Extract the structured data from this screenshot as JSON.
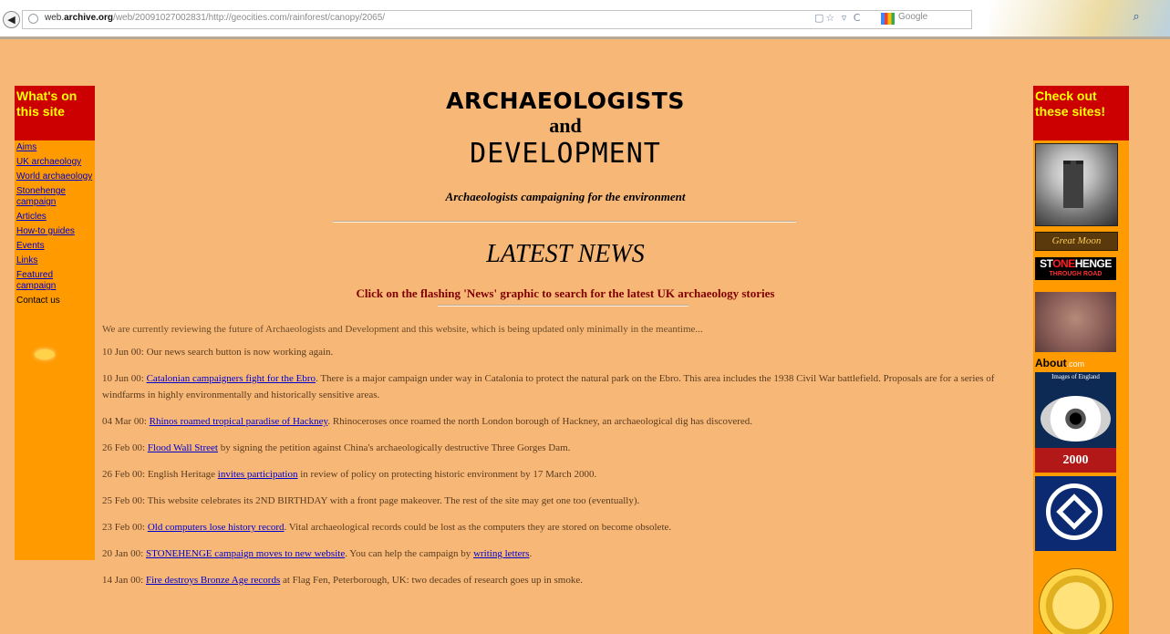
{
  "browser": {
    "url_prefix": "web.",
    "url_host": "archive.org",
    "url_path": "/web/20091027002831/http://geocities.com/rainforest/canopy/2065/",
    "search_placeholder": "Google",
    "back_icon": "arrow-left-icon",
    "toolbar_icons": "▢☆ ▿ C"
  },
  "leftnav": {
    "heading": "What's on this site",
    "links": [
      "Aims",
      "UK archaeology",
      "World archaeology",
      "Stonehenge campaign",
      "Articles",
      "How-to guides",
      "Events",
      "Links",
      "Featured campaign"
    ],
    "contact": "Contact us"
  },
  "header": {
    "title_line1": "ARCHAEOLOGISTS",
    "title_line2": "and",
    "title_line3": "DEVELOPMENT",
    "tagline": "Archaeologists campaigning for the environment"
  },
  "latest": {
    "heading": "LATEST NEWS",
    "flash_note": "Click on the flashing 'News' graphic to search for the latest UK archaeology stories"
  },
  "news": {
    "intro": "We are currently reviewing the future of Archaeologists and Development and this website, which is being updated only minimally in the meantime...",
    "items": [
      {
        "date": "10 Jun 00: ",
        "link": "",
        "text": "Our news search button is now working again."
      },
      {
        "date": "10 Jun 00: ",
        "link": "Catalonian campaigners fight for the Ebro",
        "text": ". There is a major campaign under way in Catalonia to protect the natural park on the Ebro. This area includes the 1938 Civil War battlefield. Proposals are for a series of windfarms in highly environmentally and historically sensitive areas."
      },
      {
        "date": "04 Mar 00: ",
        "link": "Rhinos roamed tropical paradise of Hackney",
        "text": ". Rhinoceroses once roamed the north London borough of Hackney, an archaeological dig has discovered."
      },
      {
        "date": "26 Feb 00: ",
        "link": "Flood Wall Street",
        "text": " by signing the petition against China's archaeologically destructive Three Gorges Dam."
      },
      {
        "date": "26 Feb 00: ",
        "pre": "English Heritage ",
        "link": "invites participation",
        "text": " in review of policy on protecting historic environment by 17 March 2000."
      },
      {
        "date": "25 Feb 00: ",
        "link": "",
        "text": "This website celebrates its 2ND BIRTHDAY with a front page makeover. The rest of the site may get one too (eventually)."
      },
      {
        "date": "23 Feb 00: ",
        "link": "Old computers lose history record",
        "text": ". Vital archaeological records could be lost as the computers they are stored on become obsolete."
      },
      {
        "date": "20 Jan 00: ",
        "link": "STONEHENGE campaign moves to new website",
        "text": ". You can help the campaign by ",
        "link2": "writing letters",
        "text2": "."
      },
      {
        "date": "14 Jan 00: ",
        "link": "Fire destroys Bronze Age records",
        "text": " at Flag Fen, Peterborough, UK: two decades of research goes up in smoke."
      }
    ]
  },
  "rightcol": {
    "heading": "Check out these sites!",
    "badges": {
      "moon": "Great Moon",
      "stonehenge_big_a": "ST",
      "stonehenge_big_b": "ONE",
      "stonehenge_big_c": "HENGE",
      "stonehenge_small": "THROUGH ROAD",
      "about": "About",
      "about_suffix": ".com",
      "eye_caption": "Images of England",
      "eye_year": "2000"
    }
  },
  "colors": {
    "page_bg": "#f7b877",
    "nav_bg": "#ff9a00",
    "nav_head_bg": "#cc0000",
    "nav_head_text": "#ffff00",
    "link": "#0000cc"
  }
}
